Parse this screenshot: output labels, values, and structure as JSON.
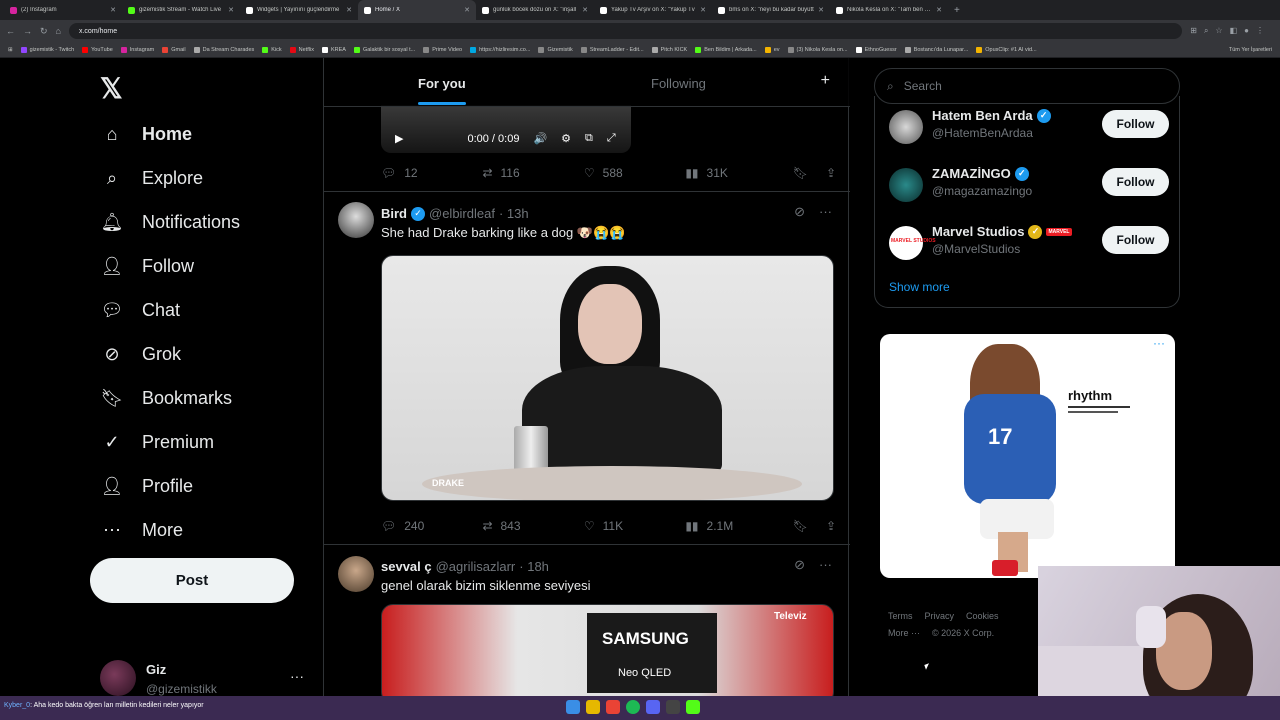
{
  "browser": {
    "tabs": [
      {
        "title": "(2) Instagram",
        "color": "#d6249f"
      },
      {
        "title": "gizemistik Stream - Watch Live",
        "color": "#53fc18"
      },
      {
        "title": "Widgets | Yayınını güçlendirme",
        "color": "#ffffff"
      },
      {
        "title": "Home / X",
        "color": "#ffffff",
        "active": true
      },
      {
        "title": "günlük böcek dozu on X: \"inşall",
        "color": "#ffffff"
      },
      {
        "title": "Yakup Tv Arşiv on X: \"Yakup Tv",
        "color": "#ffffff"
      },
      {
        "title": "bms on X: \"neyi bu kadar büyütt",
        "color": "#ffffff"
      },
      {
        "title": "Nikola Kesla on X: \"Tam ben şim",
        "color": "#ffffff"
      }
    ],
    "url": "x.com/home",
    "bookmarks": [
      "gizemistik - Twitch",
      "YouTube",
      "Instagram",
      "Gmail",
      "Da Stream Charades",
      "Kick",
      "Netflix",
      "KREA",
      "Galaktik bir sosyal t...",
      "Prime Video",
      "https://hizliresim.co...",
      "Gizemistik",
      "StreamLadder - Edit...",
      "Pitch KICK",
      "Ben Bildim | Arkada...",
      "ev",
      "(3) Nikola Kesla on...",
      "EthnoGuessr",
      "Bostancı'da Lunapar...",
      "OpusClip: #1 AI vid..."
    ],
    "bookmarks_all": "Tüm Yer İşaretleri"
  },
  "sidebar": {
    "logo": "𝕏",
    "items": [
      {
        "label": "Home",
        "icon": "home-icon"
      },
      {
        "label": "Explore",
        "icon": "search-icon"
      },
      {
        "label": "Notifications",
        "icon": "bell-icon"
      },
      {
        "label": "Follow",
        "icon": "follow-icon"
      },
      {
        "label": "Chat",
        "icon": "chat-icon"
      },
      {
        "label": "Grok",
        "icon": "grok-icon"
      },
      {
        "label": "Bookmarks",
        "icon": "bookmark-icon"
      },
      {
        "label": "Premium",
        "icon": "premium-icon"
      },
      {
        "label": "Profile",
        "icon": "profile-icon"
      },
      {
        "label": "More",
        "icon": "more-icon"
      }
    ],
    "post_label": "Post",
    "account": {
      "name": "Giz",
      "handle": "@gizemistikk",
      "more": "···"
    }
  },
  "feed": {
    "tabs": [
      "For you",
      "Following"
    ],
    "plus": "+",
    "video1": {
      "time": "0:00 / 0:09"
    },
    "tweet0_actions": {
      "replies": "12",
      "reposts": "116",
      "likes": "588",
      "views": "31K"
    },
    "tweets": [
      {
        "name": "Bird",
        "handle": "@elbirdleaf",
        "time": "· 13h",
        "text": "She had Drake barking like a dog 🐶😭😭",
        "media_watermark": "DRAKE",
        "replies": "240",
        "reposts": "843",
        "likes": "11K",
        "views": "2.1M"
      },
      {
        "name": "sevval ç",
        "handle": "@agrilisazlarr",
        "time": "· 18h",
        "text": "genel olarak bizim siklenme seviyesi",
        "media_brand": "SAMSUNG",
        "media_sub": "Neo QLED",
        "media_sign": "Televiz"
      }
    ]
  },
  "right": {
    "search_placeholder": "Search",
    "who_to_follow": [
      {
        "name": "Hatem Ben Arda",
        "handle": "@HatemBenArdaa",
        "badge": "verified"
      },
      {
        "name": "ZAMAZİNGO",
        "handle": "@magazamazingo",
        "badge": "verified"
      },
      {
        "name": "Marvel Studios",
        "handle": "@MarvelStudios",
        "badge": "gold",
        "avatar_text": "MARVEL STUDIOS",
        "flag": "MARVEL"
      }
    ],
    "follow_label": "Follow",
    "show_more": "Show more",
    "ad": {
      "brand": "rhythm",
      "dots": "···"
    },
    "footer": {
      "links": [
        "Terms",
        "Privacy",
        "Cookies"
      ],
      "more": "More ···",
      "copyright": "© 2026 X Corp."
    }
  },
  "taskbar": {
    "chat_user": "Kyber_0",
    "chat_message": ": Aha kedo bakta öğren lan milletin kedileri neler yapıyor"
  }
}
